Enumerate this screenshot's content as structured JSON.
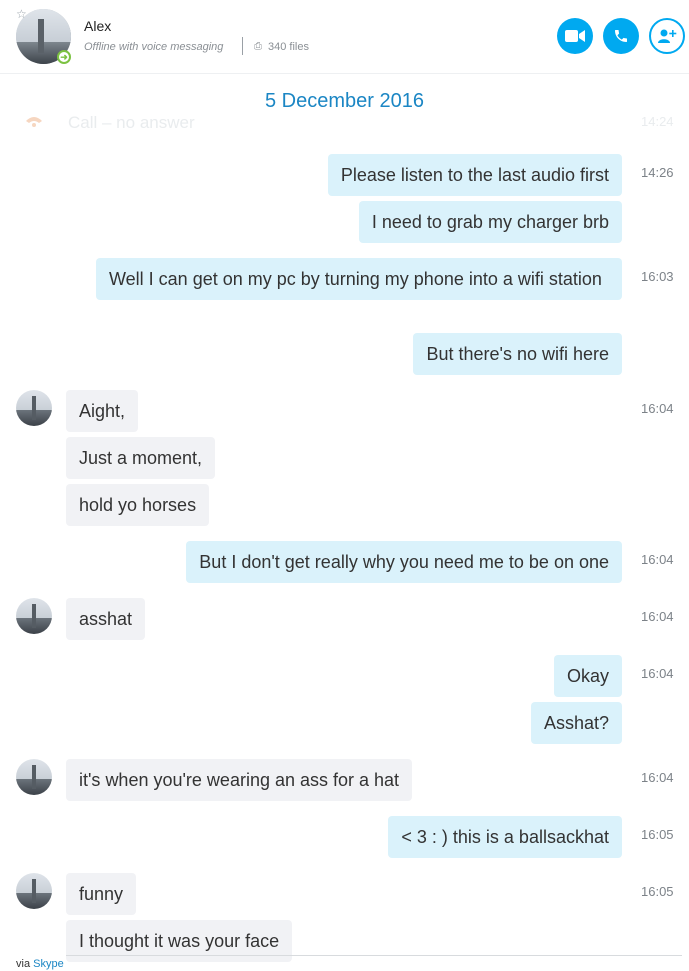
{
  "contact": {
    "name": "Alex",
    "status": "Offline with voice messaging",
    "files": "340 files"
  },
  "actions": {
    "video_icon": "video-camera-icon",
    "call_icon": "phone-icon",
    "add_icon": "add-person-icon"
  },
  "colors": {
    "accent": "#00a9f0",
    "date": "#1b86c4",
    "outgoing_bubble": "#daf2fb",
    "incoming_bubble": "#f1f2f5"
  },
  "faded_row": {
    "text": "Call – no answer",
    "time": "14:24"
  },
  "date_heading": "5 December 2016",
  "messages": [
    {
      "dir": "out",
      "text": "Please listen to the last audio first",
      "time": "14:26"
    },
    {
      "dir": "out",
      "text": "I need to grab my charger brb"
    },
    {
      "dir": "out",
      "text": "Well I can get on my pc by turning my phone into a wifi station",
      "time": "16:03"
    },
    {
      "dir": "out",
      "text": "But there's no wifi here"
    },
    {
      "dir": "in",
      "text": "Aight,",
      "time": "16:04"
    },
    {
      "dir": "in",
      "text": "Just a moment,"
    },
    {
      "dir": "in",
      "text": "hold yo horses"
    },
    {
      "dir": "out",
      "text": "But I don't get really why you need me to be on one",
      "time": "16:04"
    },
    {
      "dir": "in",
      "text": "asshat",
      "time": "16:04"
    },
    {
      "dir": "out",
      "text": "Okay",
      "time": "16:04"
    },
    {
      "dir": "out",
      "text": "Asshat?"
    },
    {
      "dir": "in",
      "text": "it's when you're wearing an ass for a hat",
      "time": "16:04"
    },
    {
      "dir": "out",
      "text": "< 3 : ) this is a ballsackhat",
      "time": "16:05"
    },
    {
      "dir": "in",
      "text": "funny",
      "time": "16:05"
    },
    {
      "dir": "in",
      "text": "I thought it was your face"
    }
  ],
  "footer": {
    "via": "via",
    "link": "Skype"
  }
}
